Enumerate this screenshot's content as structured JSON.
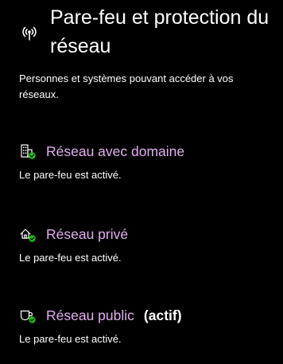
{
  "header": {
    "icon": "wireless-antenna-icon",
    "title": "Pare-feu et protection du réseau"
  },
  "description": "Personnes et systèmes pouvant accéder à vos réseaux.",
  "colors": {
    "background": "#000000",
    "link": "#e4aef2",
    "text": "#ffffff",
    "status_ok": "#16c60c"
  },
  "networks": [
    {
      "icon": "domain-network-icon",
      "name": "Réseau avec domaine",
      "active_label": "",
      "status": "Le pare-feu est activé."
    },
    {
      "icon": "private-network-icon",
      "name": "Réseau privé",
      "active_label": "",
      "status": "Le pare-feu est activé."
    },
    {
      "icon": "public-network-icon",
      "name": "Réseau public",
      "active_label": "(actif)",
      "status": "Le pare-feu est activé."
    }
  ]
}
